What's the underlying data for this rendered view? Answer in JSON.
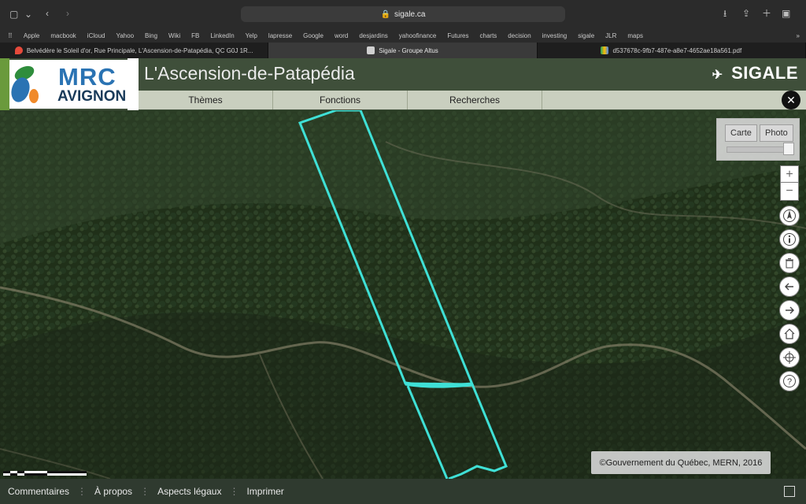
{
  "browser": {
    "url": "sigale.ca",
    "bookmarks": [
      "Apple",
      "macbook",
      "iCloud",
      "Yahoo",
      "Bing",
      "Wiki",
      "FB",
      "LinkedIn",
      "Yelp",
      "lapresse",
      "Google",
      "word",
      "desjardins",
      "yahoofinance",
      "Futures",
      "charts",
      "decision",
      "investing",
      "sigale",
      "JLR",
      "maps"
    ],
    "tabs": [
      {
        "label": "Belvédère le Soleil d'or, Rue Principale, L'Ascension-de-Patapédia, QC G0J 1R...",
        "icon": "maps-pin-icon"
      },
      {
        "label": "Sigale - Groupe Altus",
        "icon": "sigale-favicon"
      },
      {
        "label": "d537678c-9fb7-487e-a8e7-4652ae18a561.pdf",
        "icon": "drive-icon"
      }
    ]
  },
  "app": {
    "logo": {
      "line1": "MRC",
      "line2": "AVIGNON"
    },
    "title": "L'Ascension-de-Patapédia",
    "brand": "SIGALE",
    "menu": {
      "items": [
        "Thèmes",
        "Fonctions",
        "Recherches"
      ]
    }
  },
  "map": {
    "layer_switch": {
      "carte": "Carte",
      "photo": "Photo"
    },
    "copyright": "©Gouvernement du Québec, MERN, 2016",
    "tools": [
      "zoom-in-icon",
      "zoom-out-icon",
      "compass-icon",
      "info-icon",
      "trash-icon",
      "back-arrow-icon",
      "forward-arrow-icon",
      "home-icon",
      "crosshair-icon",
      "help-icon"
    ]
  },
  "footer": {
    "links": [
      "Commentaires",
      "À propos",
      "Aspects légaux",
      "Imprimer"
    ]
  },
  "colors": {
    "parcel_outline": "#3fe0d6",
    "header_bg": "#3f4f3a",
    "menu_bg": "#c9cfbf",
    "footer_bg": "#2f3a2f",
    "forest_base": "#233020"
  }
}
